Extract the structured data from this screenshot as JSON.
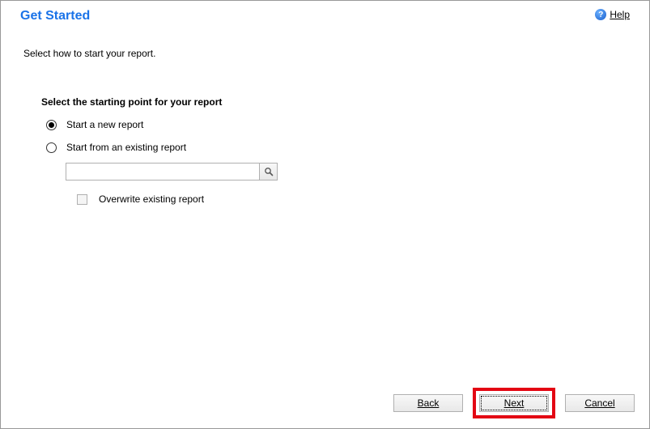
{
  "header": {
    "title": "Get Started",
    "help_label": "Help",
    "help_glyph": "?"
  },
  "instruction": "Select how to start your report.",
  "section": {
    "heading": "Select the starting point for your report",
    "option_new": "Start a new report",
    "option_existing": "Start from an existing report",
    "existing_path": "",
    "overwrite_label": "Overwrite existing report"
  },
  "buttons": {
    "back": "Back",
    "next": "Next",
    "cancel": "Cancel"
  }
}
